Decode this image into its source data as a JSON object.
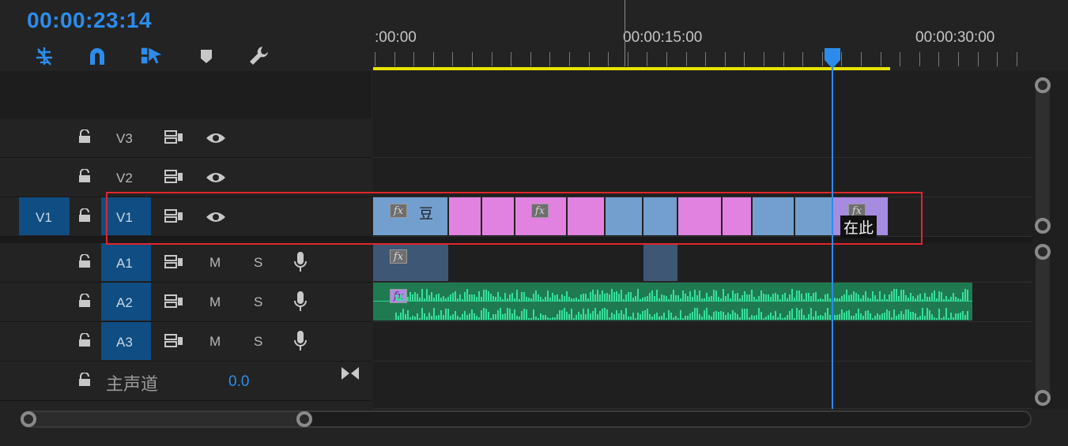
{
  "timecode": "00:00:23:14",
  "toolbar": {
    "tools": [
      "nest-icon",
      "snap-magnet-icon",
      "linked-selection-icon",
      "add-marker-icon",
      "settings-wrench-icon"
    ]
  },
  "ruler": {
    "labels": [
      ":00:00",
      "00:00:15:00",
      "00:00:30:00"
    ]
  },
  "tracks": {
    "v3": {
      "label": "V3"
    },
    "v2": {
      "label": "V2"
    },
    "v1": {
      "source_label": "V1",
      "label": "V1"
    },
    "a1": {
      "label": "A1",
      "mute": "M",
      "solo": "S"
    },
    "a2": {
      "label": "A2",
      "mute": "M",
      "solo": "S"
    },
    "a3": {
      "label": "A3",
      "mute": "M",
      "solo": "S"
    },
    "master": {
      "label": "主声道",
      "value": "0.0"
    }
  },
  "clips": {
    "v1_first_text": "豆",
    "v1_last_text": "在此",
    "fx": "fx"
  },
  "colors": {
    "accent": "#2d8ceb",
    "clip_blue": "#739fcf",
    "clip_pink": "#e282e0",
    "clip_purple": "#a58ce0",
    "audio_green": "#1f8a5a",
    "highlight_red": "#e1262c",
    "work_area_yellow": "#e8e300"
  }
}
